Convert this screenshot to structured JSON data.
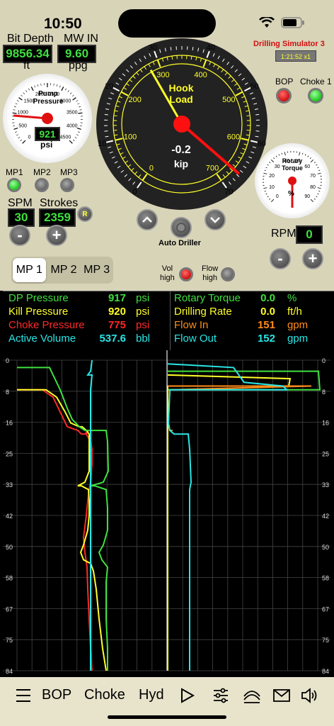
{
  "status_bar": {
    "time": "10:50"
  },
  "app": {
    "title": "Drilling Simulator 3",
    "clock": "1:21:52 x1"
  },
  "bit_depth": {
    "label": "Bit Depth",
    "value": "9856.34",
    "unit": "ft"
  },
  "mw_in": {
    "label": "MW IN",
    "value": "9.60",
    "unit": "ppg"
  },
  "pump_pressure_gauge": {
    "title_line1": "Pump",
    "title_line2": "Pressure",
    "value": "921",
    "unit": "psi",
    "scale": [
      "0",
      "500",
      "1000",
      "1500",
      "2000",
      "2500",
      "3000",
      "3500",
      "4000",
      "4500"
    ],
    "reading": 921,
    "max": 5000
  },
  "hook_load_gauge": {
    "title_line1": "Hook",
    "title_line2": "Load",
    "value": "-0.2",
    "unit": "kip",
    "outer_scale": [
      "0",
      "10",
      "20",
      "30",
      "40",
      "50",
      "60",
      "70"
    ],
    "inner_scale": [
      "0",
      "100",
      "200",
      "300",
      "400",
      "500",
      "600",
      "700"
    ]
  },
  "rotary_torque_gauge": {
    "title_line1": "Rotary",
    "title_line2": "Torque",
    "unit": "%",
    "scale": [
      "0",
      "10",
      "20",
      "30",
      "40",
      "50",
      "60",
      "70",
      "80",
      "90"
    ]
  },
  "controls": {
    "bop_label": "BOP",
    "choke_label": "Choke 1",
    "mp1": "MP1",
    "mp2": "MP2",
    "mp3": "MP3",
    "spm_label": "SPM",
    "spm_value": "30",
    "strokes_label": "Strokes",
    "strokes_value": "2359",
    "reset_label": "R",
    "minus": "-",
    "plus": "+",
    "auto_driller": "Auto Driller",
    "rpm_label": "RPM",
    "rpm_value": "0",
    "vol_high_1": "Vol",
    "vol_high_2": "high",
    "flow_high_1": "Flow",
    "flow_high_2": "high"
  },
  "mp_tabs": [
    {
      "label": "MP 1"
    },
    {
      "label": "MP 2"
    },
    {
      "label": "MP 3"
    }
  ],
  "readouts_left": [
    {
      "name": "DP Pressure",
      "value": "917",
      "unit": "psi",
      "color": "#3fe03f"
    },
    {
      "name": "Kill Pressure",
      "value": "920",
      "unit": "psi",
      "color": "#ffff2a"
    },
    {
      "name": "Choke Pressure",
      "value": "775",
      "unit": "psi",
      "color": "#ff2a2a"
    },
    {
      "name": "Active Volume",
      "value": "537.6",
      "unit": "bbl",
      "color": "#2ae6e6"
    }
  ],
  "readouts_right": [
    {
      "name": "Rotary Torque",
      "value": "0.0",
      "unit": "%",
      "color": "#3fe03f"
    },
    {
      "name": "Drilling Rate",
      "value": "0.0",
      "unit": "ft/h",
      "color": "#ffff2a"
    },
    {
      "name": "Flow In",
      "value": "151",
      "unit": "gpm",
      "color": "#ff8c1a"
    },
    {
      "name": "Flow Out",
      "value": "152",
      "unit": "gpm",
      "color": "#2ae6e6"
    }
  ],
  "chart_data": {
    "type": "line",
    "y_ticks": [
      "0",
      "8",
      "16",
      "25",
      "33",
      "42",
      "50",
      "58",
      "67",
      "75",
      "84"
    ],
    "y_range": [
      0,
      84
    ],
    "orientation": "vertical-time",
    "grid": true
  },
  "toolbar": {
    "bop": "BOP",
    "choke": "Choke",
    "hyd": "Hyd"
  },
  "colors": {
    "panel": "#d8d4b8",
    "digital_green": "#3fe03f",
    "lamp_red": "#d01010",
    "lamp_green": "#1ec81e"
  }
}
